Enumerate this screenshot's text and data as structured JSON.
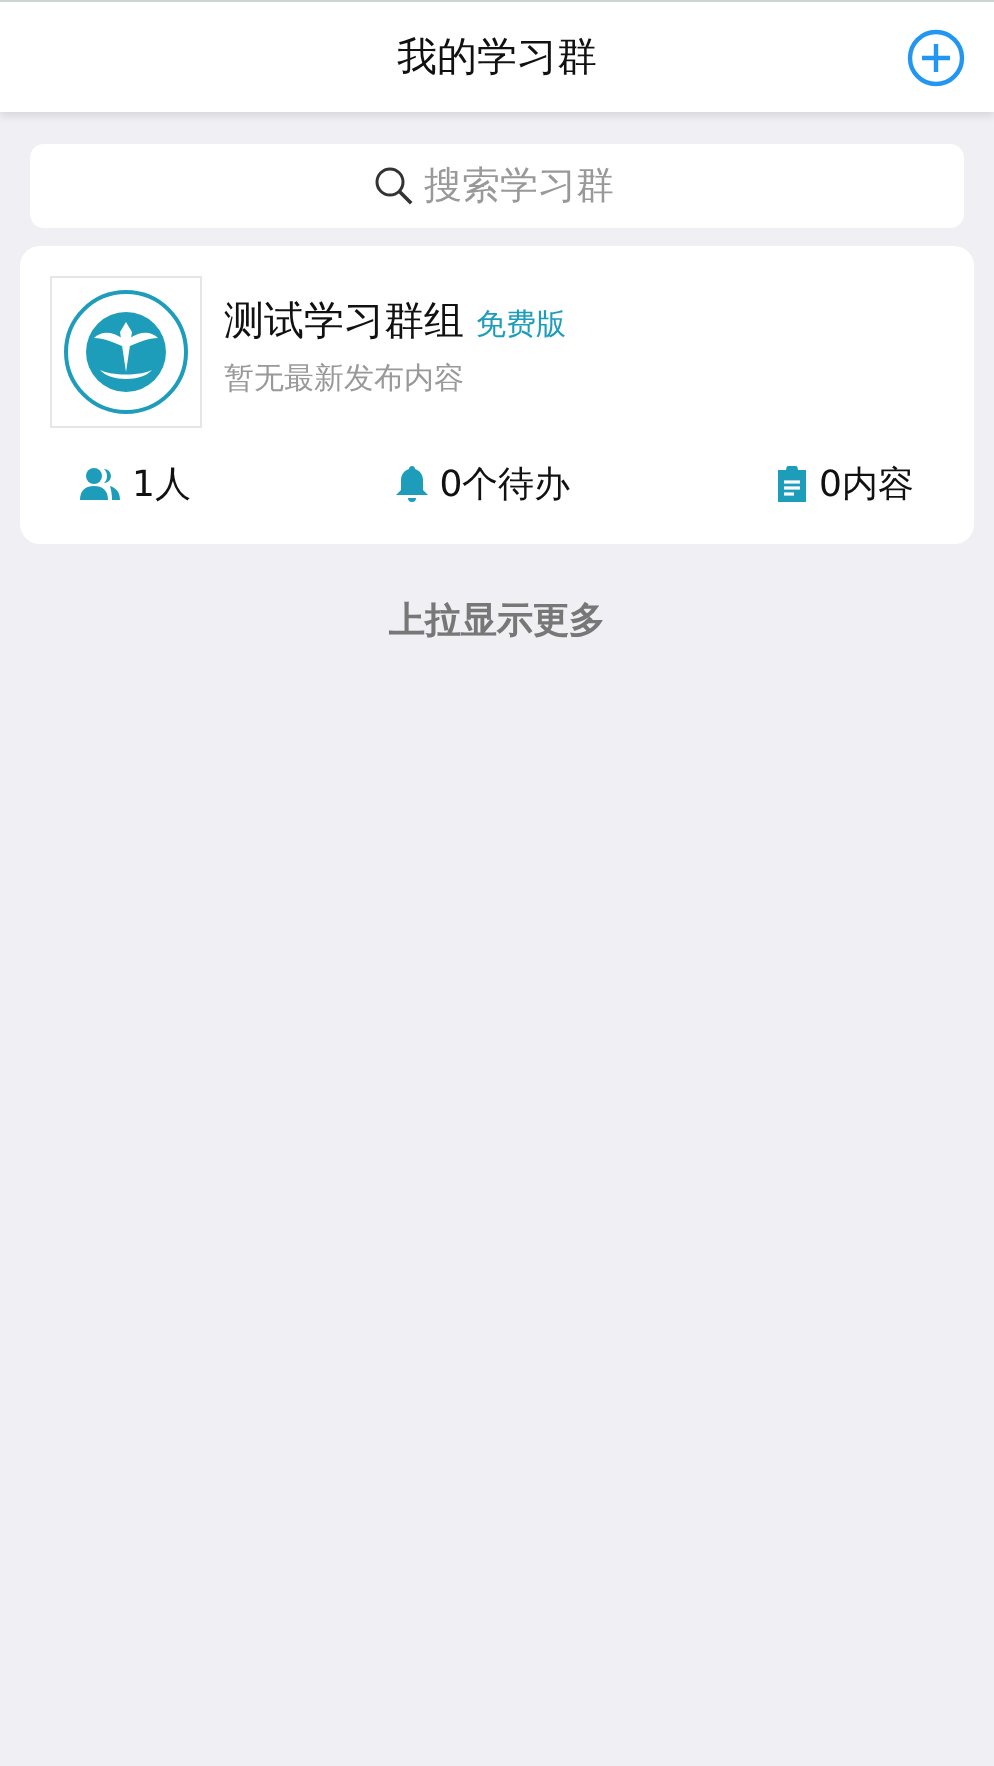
{
  "header": {
    "title": "我的学习群"
  },
  "search": {
    "placeholder": "搜索学习群"
  },
  "groups": [
    {
      "name": "测试学习群组",
      "badge": "免费版",
      "latest": "暂无最新发布内容",
      "stats": [
        {
          "kind": "members",
          "text": "1人"
        },
        {
          "kind": "todos",
          "text": "0个待办"
        },
        {
          "kind": "contents",
          "text": "0内容"
        }
      ]
    }
  ],
  "footer": {
    "text": "上拉显示更多"
  }
}
